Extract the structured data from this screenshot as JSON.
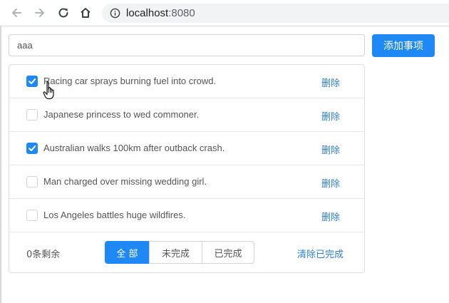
{
  "browser": {
    "url_host": "localhost",
    "url_port": ":8080",
    "back_icon": "arrow-left-icon",
    "forward_icon": "arrow-right-icon",
    "reload_icon": "reload-icon",
    "home_icon": "home-icon",
    "info_icon": "info-icon"
  },
  "input": {
    "value": "aaa",
    "placeholder": ""
  },
  "add_button_label": "添加事项",
  "todos": [
    {
      "text": "Racing car sprays burning fuel into crowd.",
      "done": true,
      "delete_label": "删除"
    },
    {
      "text": "Japanese princess to wed commoner.",
      "done": false,
      "delete_label": "删除"
    },
    {
      "text": "Australian walks 100km after outback crash.",
      "done": true,
      "delete_label": "删除"
    },
    {
      "text": "Man charged over missing wedding girl.",
      "done": false,
      "delete_label": "删除"
    },
    {
      "text": "Los Angeles battles huge wildfires.",
      "done": false,
      "delete_label": "删除"
    }
  ],
  "footer": {
    "remaining": "0条剩余",
    "filters": [
      {
        "label": "全 部",
        "active": true
      },
      {
        "label": "未完成",
        "active": false
      },
      {
        "label": "已完成",
        "active": false
      }
    ],
    "clear_label": "清除已完成"
  },
  "colors": {
    "accent": "#1e88f5",
    "link": "#2f80d8"
  }
}
